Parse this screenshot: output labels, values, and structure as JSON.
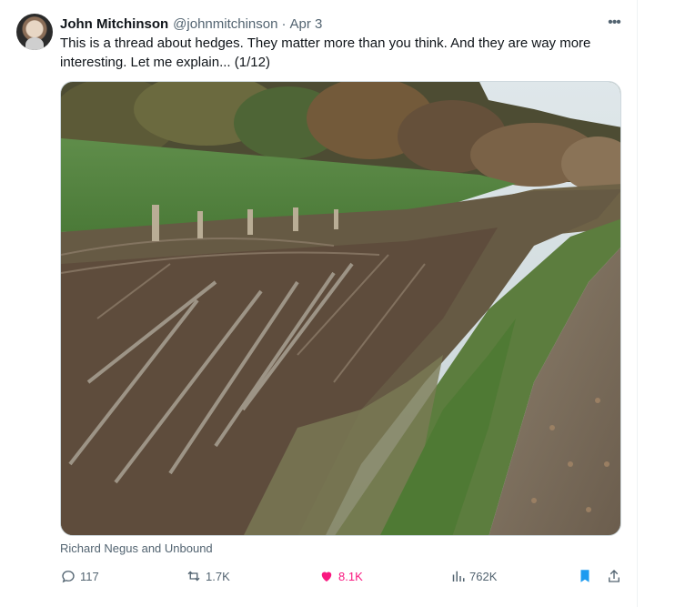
{
  "tweet": {
    "author_name": "John Mitchinson",
    "handle": "@johnmitchinson",
    "separator": "·",
    "date": "Apr 3",
    "more_label": "•••",
    "text": "This is a thread about hedges. They matter more than you think. And they are way more interesting. Let me explain... (1/12)",
    "photo_credit": "Richard Negus and Unbound"
  },
  "actions": {
    "replies": "117",
    "reposts": "1.7K",
    "likes": "8.1K",
    "views": "762K"
  },
  "colors": {
    "text": "#0f1419",
    "muted": "#536471",
    "like": "#f91880",
    "bookmark": "#1d9bf0"
  }
}
